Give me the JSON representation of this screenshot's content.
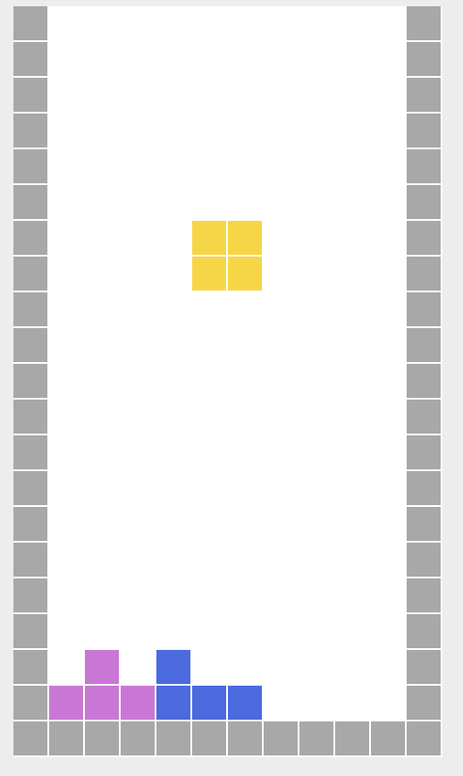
{
  "game": {
    "columns": 12,
    "rows": 21,
    "colors": {
      "wall": "#a8a8a8",
      "O": "#f6d647",
      "T": "#c878d4",
      "J": "#4a6ade",
      "empty": "#ffffff",
      "background": "#ededed"
    },
    "active_piece": {
      "type": "O",
      "cells": [
        [
          5,
          6
        ],
        [
          6,
          6
        ],
        [
          5,
          7
        ],
        [
          6,
          7
        ]
      ]
    },
    "locked_cells": [
      {
        "type": "T",
        "col": 2,
        "row": 18
      },
      {
        "type": "T",
        "col": 1,
        "row": 19
      },
      {
        "type": "T",
        "col": 2,
        "row": 19
      },
      {
        "type": "T",
        "col": 3,
        "row": 19
      },
      {
        "type": "J",
        "col": 4,
        "row": 18
      },
      {
        "type": "J",
        "col": 4,
        "row": 19
      },
      {
        "type": "J",
        "col": 5,
        "row": 19
      },
      {
        "type": "J",
        "col": 6,
        "row": 19
      }
    ]
  }
}
